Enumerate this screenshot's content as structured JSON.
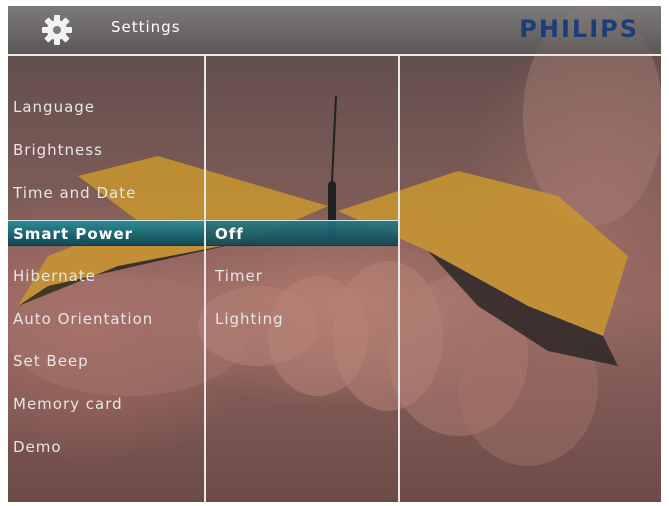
{
  "header": {
    "title": "Settings",
    "brand": "PHILIPS",
    "icon": "gear-icon"
  },
  "settings_menu": {
    "selected_index": 4,
    "items": [
      {
        "label": "Language"
      },
      {
        "label": "Brightness"
      },
      {
        "label": "Time and Date"
      },
      {
        "label": "Smart Power"
      },
      {
        "label": "Hibernate"
      },
      {
        "label": "Auto Orientation"
      },
      {
        "label": "Set Beep"
      },
      {
        "label": "Memory card"
      },
      {
        "label": "Demo"
      }
    ]
  },
  "submenu": {
    "selected_index": 0,
    "items": [
      {
        "label": "Off"
      },
      {
        "label": "Timer"
      },
      {
        "label": "Lighting"
      }
    ]
  },
  "colors": {
    "brand": "#1b3e78",
    "highlight": "#1f7f8a",
    "text": "#e6e6e6"
  },
  "background": "butterfly-photo"
}
